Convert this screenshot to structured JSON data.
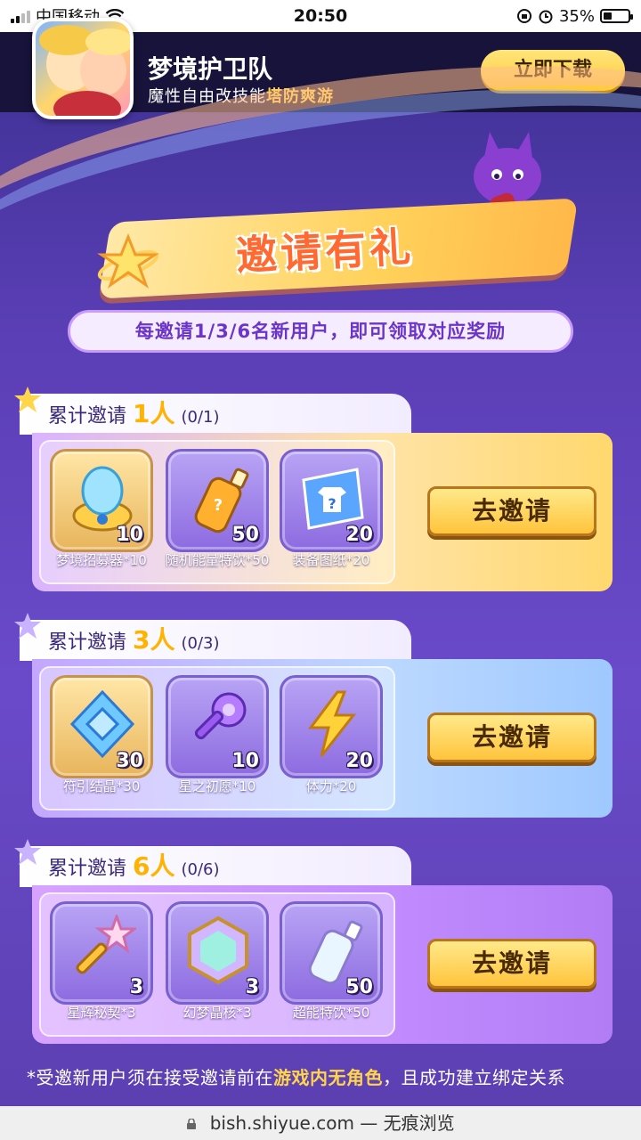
{
  "status_bar": {
    "carrier": "中国移动",
    "time": "20:50",
    "battery": "35%",
    "battery_level": 0.35
  },
  "banner": {
    "app_name": "梦境护卫队",
    "tagline_prefix": "魔性自由改技能",
    "tagline_highlight": "塔防爽游",
    "download_label": "立即下载"
  },
  "hero": {
    "title": "邀请有礼",
    "subtitle": "每邀请1/3/6名新用户，即可领取对应奖励"
  },
  "sections": [
    {
      "prefix": "累计邀请",
      "count": "1人",
      "progress": "(0/1)",
      "button": "去邀请",
      "items": [
        {
          "label": "梦境招募器*10",
          "count": "10",
          "icon": "recruiter-icon"
        },
        {
          "label": "随机能量特饮*50",
          "count": "50",
          "icon": "energy-drink-icon"
        },
        {
          "label": "装备图纸*20",
          "count": "20",
          "icon": "blueprint-icon"
        }
      ]
    },
    {
      "prefix": "累计邀请",
      "count": "3人",
      "progress": "(0/3)",
      "button": "去邀请",
      "items": [
        {
          "label": "符引结晶*30",
          "count": "30",
          "icon": "crystal-icon"
        },
        {
          "label": "星之初愿*10",
          "count": "10",
          "icon": "key-icon"
        },
        {
          "label": "体力*20",
          "count": "20",
          "icon": "lightning-icon"
        }
      ]
    },
    {
      "prefix": "累计邀请",
      "count": "6人",
      "progress": "(0/6)",
      "button": "去邀请",
      "items": [
        {
          "label": "星辉秘契*3",
          "count": "3",
          "icon": "star-key-icon"
        },
        {
          "label": "幻梦晶核*3",
          "count": "3",
          "icon": "dream-core-icon"
        },
        {
          "label": "超能特饮*50",
          "count": "50",
          "icon": "super-drink-icon"
        }
      ]
    }
  ],
  "footnote": {
    "prefix": "*受邀新用户须在接受邀请前在",
    "highlight": "游戏内无角色",
    "suffix": "，且成功建立绑定关系"
  },
  "url_bar": {
    "text": "bish.shiyue.com — 无痕浏览"
  },
  "colors": {
    "accent": "#ffc93b",
    "background": "#5b3fb6",
    "highlight_text": "#ffd54a"
  }
}
